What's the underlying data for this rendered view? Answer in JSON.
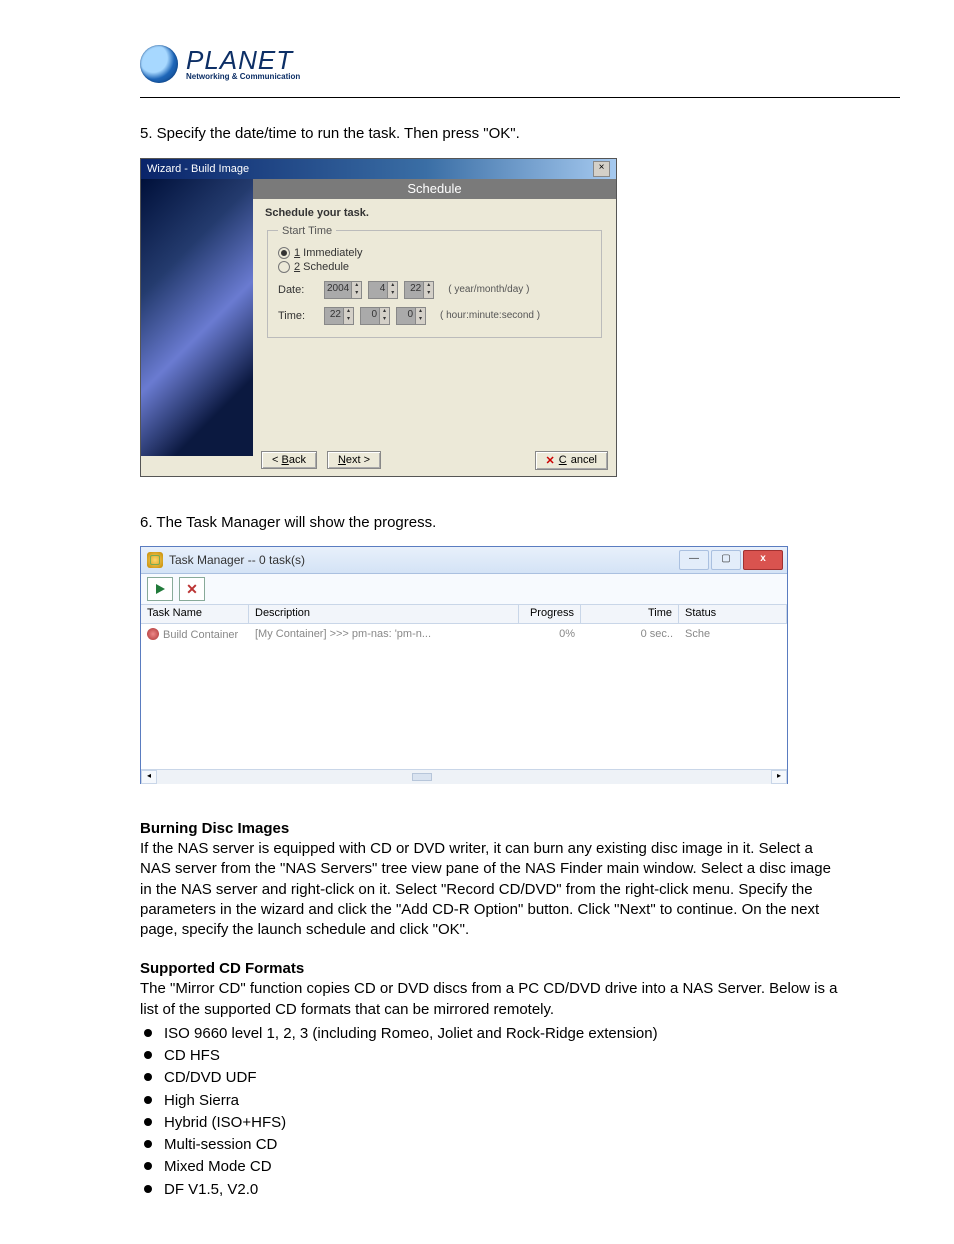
{
  "branding": {
    "name": "PLANET",
    "tagline": "Networking & Communication"
  },
  "steps": {
    "step5": "5. Specify the date/time to run the task. Then press \"OK\".",
    "step6": "6. The Task Manager will show the progress."
  },
  "dialog1": {
    "title": "Wizard - Build Image",
    "header": "Schedule",
    "prompt": "Schedule your task.",
    "groupLabel": "Start Time",
    "opt1_num": "1",
    "opt1_label": " Immediately",
    "opt2_num": "2",
    "opt2_label": " Schedule",
    "dateLabel": "Date:",
    "timeLabel": "Time:",
    "date": {
      "year": "2004",
      "month": "4",
      "day": "22"
    },
    "time": {
      "hour": "22",
      "minute": "0",
      "second": "0"
    },
    "dateHint": "( year/month/day )",
    "timeHint": "( hour:minute:second )",
    "backLabel": "< Back",
    "nextLabel": "Next >",
    "cancelLabel": "Cancel",
    "backU": "B",
    "nextU": "N",
    "cancelU": "C"
  },
  "dialog2": {
    "title": "Task Manager -- 0 task(s)",
    "closeGlyph": "x",
    "columns": {
      "task": "Task Name",
      "desc": "Description",
      "prog": "Progress",
      "time": "Time",
      "status": "Status"
    },
    "row": {
      "task": "Build Container",
      "desc": "[My Container] >>> pm-nas: 'pm-n...",
      "prog": "0%",
      "time": "0 sec..",
      "status": "Sche"
    }
  },
  "sections": {
    "burning_title": "Burning Disc Images",
    "burning_body": "If the NAS server is equipped with CD or DVD writer, it can burn any existing disc image in it. Select a NAS server from the \"NAS Servers\" tree view pane of the NAS Finder main window. Select a disc image in the NAS server and right-click on it. Select \"Record CD/DVD\" from the right-click menu. Specify the parameters in the wizard and click the \"Add CD-R Option\" button. Click \"Next\" to continue. On the next page, specify the launch schedule and click \"OK\".",
    "formats_title": "Supported CD Formats",
    "formats_intro": "The \"Mirror CD\" function copies CD or DVD discs from a PC CD/DVD drive into a NAS Server. Below is a list of the supported CD formats that can be mirrored remotely.",
    "formats": [
      "ISO 9660 level 1, 2, 3 (including Romeo, Joliet and Rock-Ridge extension)",
      "CD HFS",
      "CD/DVD UDF",
      "High Sierra",
      "Hybrid (ISO+HFS)",
      "Multi-session CD",
      "Mixed Mode CD",
      "DF V1.5, V2.0"
    ]
  }
}
